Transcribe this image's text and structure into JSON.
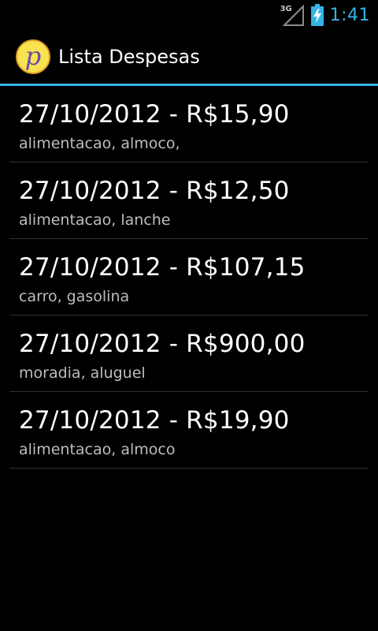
{
  "status_bar": {
    "network_type": "3G",
    "time": "1:41",
    "icons": [
      "signal-icon",
      "battery-charging-icon"
    ],
    "accent_color": "#33b5e5"
  },
  "action_bar": {
    "logo_letter": "p",
    "title": "Lista Despesas",
    "divider_color": "#33b5e5"
  },
  "expenses": [
    {
      "title": "27/10/2012 - R$15,90",
      "subtitle": "alimentacao, almoco,"
    },
    {
      "title": "27/10/2012 - R$12,50",
      "subtitle": "alimentacao, lanche"
    },
    {
      "title": "27/10/2012 - R$107,15",
      "subtitle": "carro, gasolina"
    },
    {
      "title": "27/10/2012 - R$900,00",
      "subtitle": "moradia, aluguel"
    },
    {
      "title": "27/10/2012 - R$19,90",
      "subtitle": "alimentacao, almoco"
    }
  ]
}
